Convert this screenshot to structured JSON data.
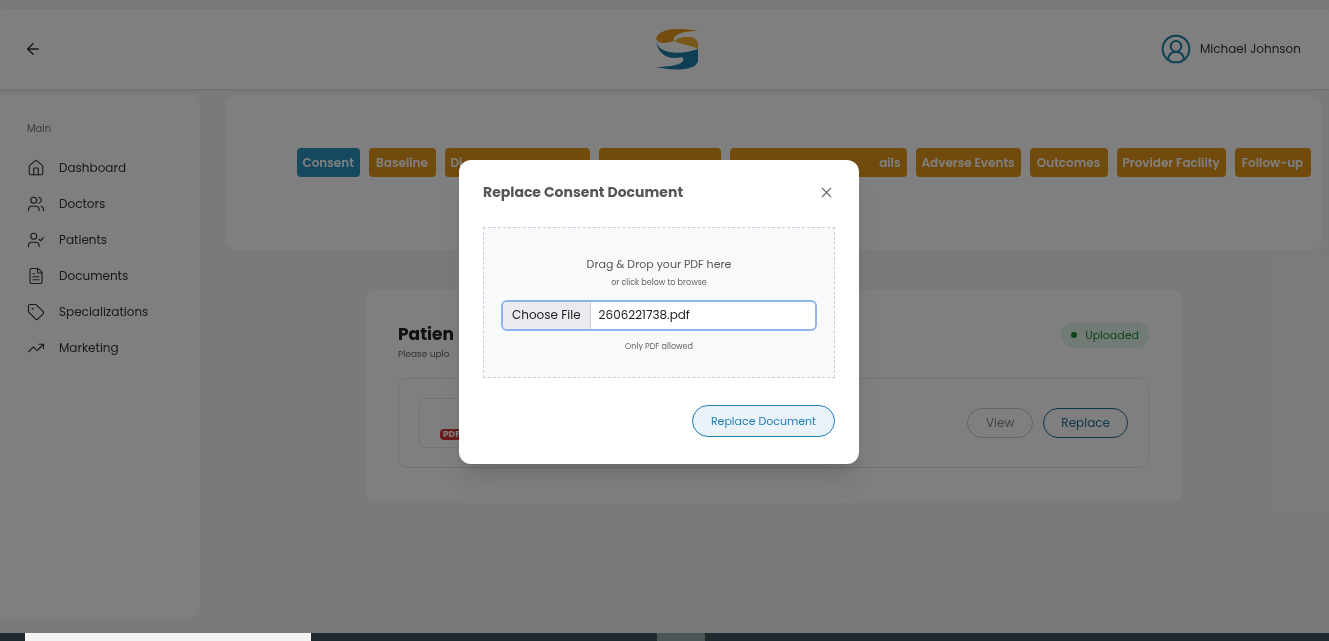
{
  "header": {
    "user_name": "Michael Johnson"
  },
  "sidebar": {
    "section": "Main",
    "items": [
      {
        "label": "Dashboard"
      },
      {
        "label": "Doctors"
      },
      {
        "label": "Patients"
      },
      {
        "label": "Documents"
      },
      {
        "label": "Specializations"
      },
      {
        "label": "Marketing"
      }
    ]
  },
  "tabs": [
    {
      "label": "Consent",
      "selected": true
    },
    {
      "label": "Baseline",
      "selected": false
    },
    {
      "label": "Di",
      "selected": false
    },
    {
      "selected": false
    },
    {
      "label": "ails",
      "selected": false
    },
    {
      "label": "Adverse Events",
      "selected": false
    },
    {
      "label": "Outcomes",
      "selected": false
    },
    {
      "label": "Provider Facility",
      "selected": false
    },
    {
      "label": "Follow-up",
      "selected": false
    }
  ],
  "document_card": {
    "title": "Patien",
    "subtitle": "Please uplo",
    "status": "Uploaded",
    "file_badge": "PDF",
    "buttons": [
      "View",
      "Replace"
    ]
  },
  "modal": {
    "title": "Replace Consent Document",
    "drop_title": "Drag & Drop your PDF here",
    "drop_hint": "or click below to browse",
    "file_button": "Choose File",
    "file_name": "2606221738.pdf",
    "note": "Only PDF allowed",
    "submit": "Replace Document"
  }
}
